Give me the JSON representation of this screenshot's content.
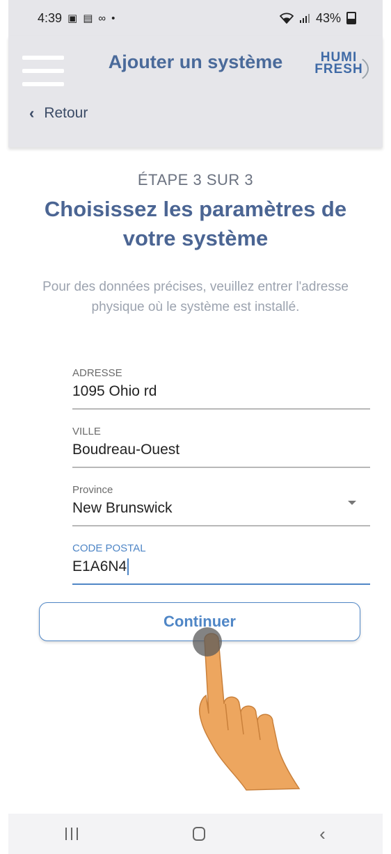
{
  "status_bar": {
    "time": "4:39",
    "battery": "43%"
  },
  "header": {
    "title": "Ajouter un système",
    "brand_line1": "HUMI",
    "brand_line2": "FRESH",
    "back_label": "Retour"
  },
  "content": {
    "step": "ÉTAPE 3 SUR 3",
    "title": "Choisissez les paramètres de votre système",
    "description": "Pour des données précises, veuillez entrer l'adresse physique où le système est installé."
  },
  "form": {
    "address": {
      "label": "ADRESSE",
      "value": "1095 Ohio rd"
    },
    "city": {
      "label": "VILLE",
      "value": "Boudreau-Ouest"
    },
    "province": {
      "label": "Province",
      "value": "New Brunswick"
    },
    "postal_code": {
      "label": "CODE POSTAL",
      "value": "E1A6N4"
    }
  },
  "continue_label": "Continuer",
  "colors": {
    "accent": "#4f86c6",
    "title": "#4b6593",
    "header_bg": "#e6e6ea"
  }
}
